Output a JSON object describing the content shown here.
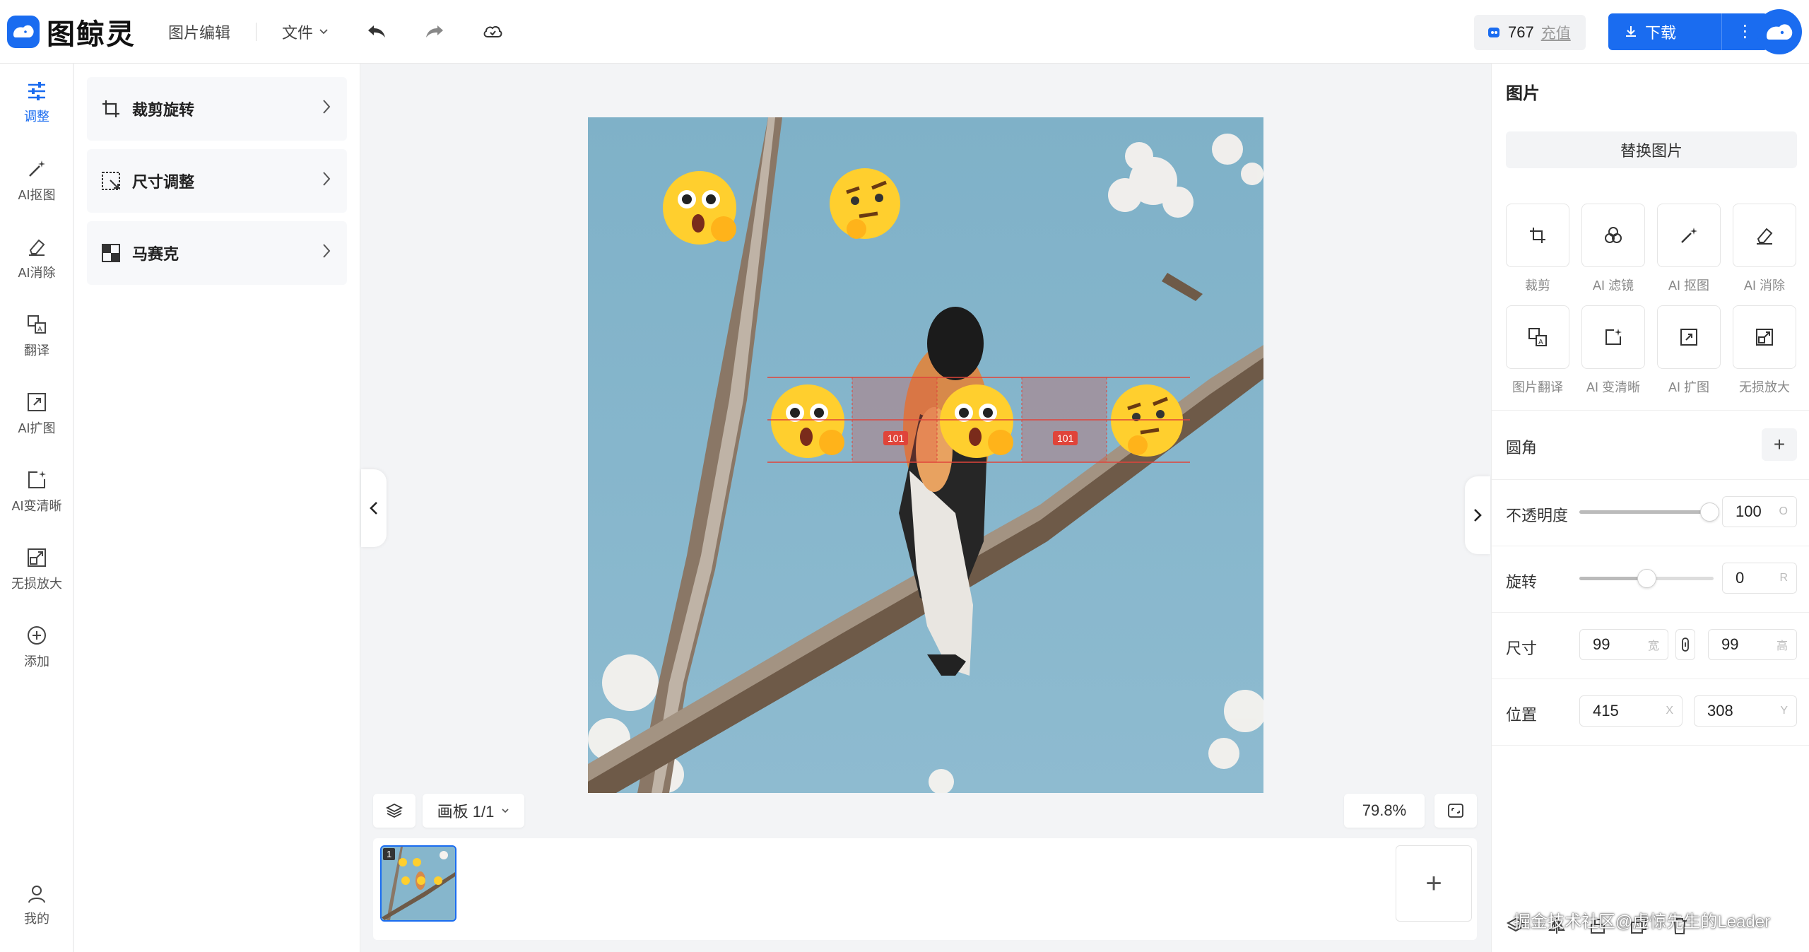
{
  "header": {
    "logo_text": "图鲸灵",
    "title": "图片编辑",
    "file_menu": "文件",
    "credits": "767",
    "recharge": "充值",
    "download": "下载",
    "more": "⋮"
  },
  "leftnav": {
    "items": [
      {
        "label": "调整",
        "icon": "sliders-icon",
        "active": true
      },
      {
        "label": "AI抠图",
        "icon": "magic-wand-icon"
      },
      {
        "label": "AI消除",
        "icon": "eraser-icon"
      },
      {
        "label": "翻译",
        "icon": "translate-icon"
      },
      {
        "label": "AI扩图",
        "icon": "expand-icon"
      },
      {
        "label": "AI变清晰",
        "icon": "sparkle-frame-icon"
      },
      {
        "label": "无损放大",
        "icon": "upscale-icon"
      },
      {
        "label": "添加",
        "icon": "plus-circle-icon"
      }
    ],
    "user_label": "我的"
  },
  "subpanel": {
    "tools": [
      {
        "label": "裁剪旋转",
        "icon": "crop-icon"
      },
      {
        "label": "尺寸调整",
        "icon": "resize-icon"
      },
      {
        "label": "马赛克",
        "icon": "mosaic-icon"
      }
    ]
  },
  "canvas": {
    "spacing_labels": [
      "101",
      "101"
    ],
    "board_label": "画板 1/1",
    "zoom": "79.8%",
    "thumb_index": "1",
    "add_page": "+"
  },
  "rightpanel": {
    "title": "图片",
    "replace": "替换图片",
    "quick_tools": [
      {
        "label": "裁剪",
        "icon": "crop-icon"
      },
      {
        "label": "AI 滤镜",
        "icon": "filter-icon"
      },
      {
        "label": "AI 抠图",
        "icon": "magic-wand-icon"
      },
      {
        "label": "AI 消除",
        "icon": "eraser-icon"
      },
      {
        "label": "图片翻译",
        "icon": "translate-icon"
      },
      {
        "label": "AI 变清晰",
        "icon": "sparkle-frame-icon"
      },
      {
        "label": "AI 扩图",
        "icon": "expand-icon"
      },
      {
        "label": "无损放大",
        "icon": "upscale-icon"
      }
    ],
    "corner_label": "圆角",
    "corner_add": "+",
    "opacity_label": "不透明度",
    "opacity_value": "100",
    "opacity_unit": "O",
    "opacity_fraction": 0.97,
    "rotate_label": "旋转",
    "rotate_value": "0",
    "rotate_unit": "R",
    "rotate_fraction": 0.5,
    "size_label": "尺寸",
    "width_value": "99",
    "width_unit": "宽",
    "height_value": "99",
    "height_unit": "高",
    "position_label": "位置",
    "x_value": "415",
    "x_unit": "X",
    "y_value": "308",
    "y_unit": "Y"
  },
  "watermark": "掘金技术社区@虚惊先生的Leader",
  "colors": {
    "accent": "#1a6cf0",
    "guide": "#e0443a"
  }
}
